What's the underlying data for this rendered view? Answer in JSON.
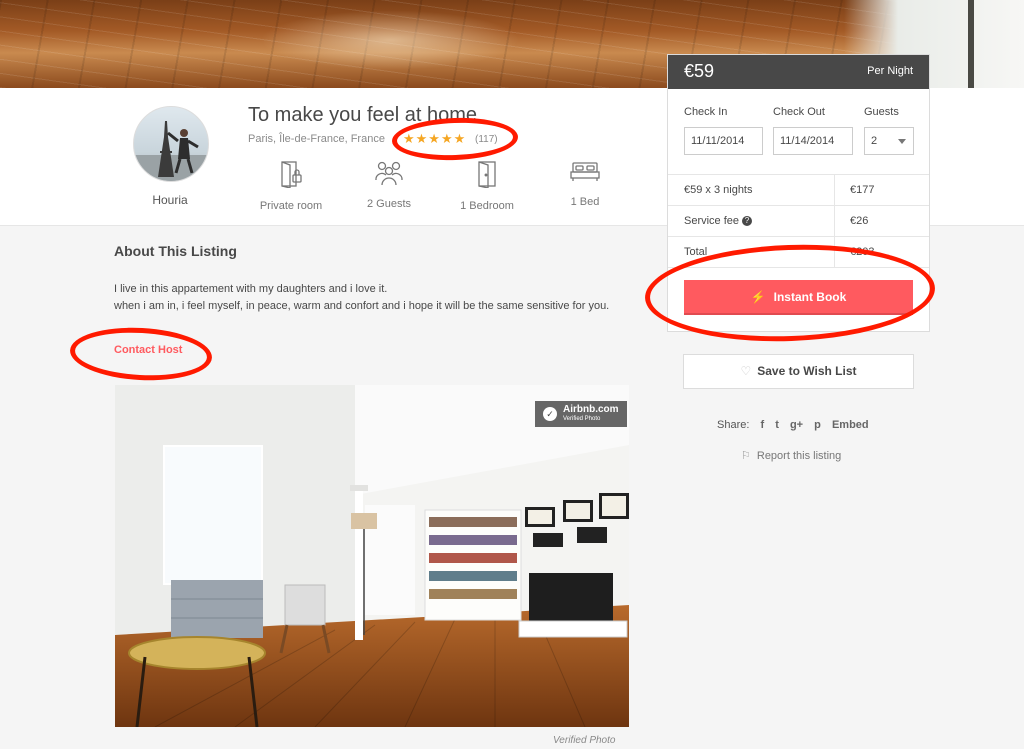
{
  "host": {
    "name": "Houria"
  },
  "listing": {
    "title": "To make you feel at home",
    "location": "Paris, Île-de-France, France",
    "stars": "★★★★★",
    "review_count": "(117)"
  },
  "features": [
    {
      "label": "Private room",
      "icon": "door-lock-icon"
    },
    {
      "label": "2 Guests",
      "icon": "guests-icon"
    },
    {
      "label": "1 Bedroom",
      "icon": "bedroom-door-icon"
    },
    {
      "label": "1 Bed",
      "icon": "bed-icon"
    }
  ],
  "about": {
    "title": "About This Listing",
    "line1": "I live in this appartement with my daughters and i love it.",
    "line2": "when i am in, i feel myself, in peace, warm and confort and i hope it will be the same sensitive for you.",
    "contact_label": "Contact Host"
  },
  "photo": {
    "badge_title": "Airbnb.com",
    "badge_sub": "Verified Photo",
    "caption": "Verified Photo"
  },
  "booking": {
    "price": "€59",
    "per": "Per Night",
    "checkin_label": "Check In",
    "checkout_label": "Check Out",
    "guests_label": "Guests",
    "checkin_value": "11/11/2014",
    "checkout_value": "11/14/2014",
    "guests_value": "2",
    "rows": [
      {
        "label": "€59 x 3 nights",
        "value": "€177"
      },
      {
        "label": "Service fee",
        "value": "€26"
      },
      {
        "label": "Total",
        "value": "€203"
      }
    ],
    "instant_book_label": "Instant Book",
    "accent": "#ff5a5f"
  },
  "wishlist": {
    "label": "Save to Wish List"
  },
  "share": {
    "label": "Share:",
    "facebook": "f",
    "twitter": "t",
    "googleplus": "g+",
    "pinterest": "p",
    "embed": "Embed",
    "report": "Report this listing"
  }
}
